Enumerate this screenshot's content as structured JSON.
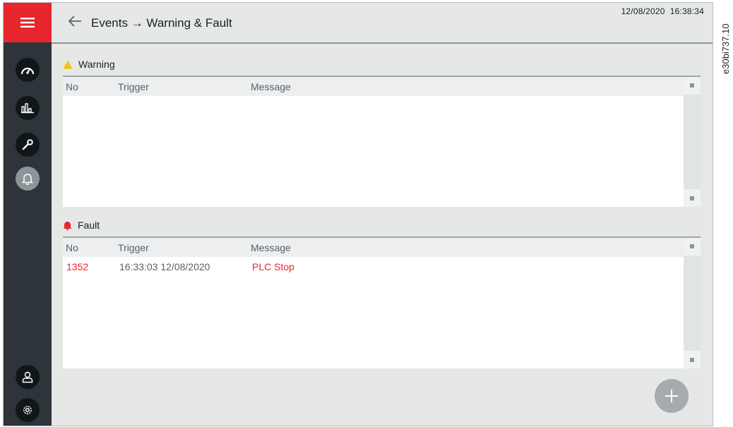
{
  "header": {
    "breadcrumb": "Events → Warning & Fault",
    "datetime": "12/08/2020  16:38:34"
  },
  "sidebar": {
    "items": [
      {
        "name": "gauge-icon",
        "active": false
      },
      {
        "name": "chart-icon",
        "active": false
      },
      {
        "name": "wrench-icon",
        "active": false
      },
      {
        "name": "bell-icon",
        "active": true
      }
    ],
    "bottom": [
      {
        "name": "user-icon"
      },
      {
        "name": "gear-icon"
      }
    ]
  },
  "warning": {
    "title": "Warning",
    "icon": "warning-triangle-icon",
    "columns": [
      "No",
      "Trigger",
      "Message"
    ],
    "rows": []
  },
  "fault": {
    "title": "Fault",
    "icon": "bell-alert-icon",
    "columns": [
      "No",
      "Trigger",
      "Message"
    ],
    "rows": [
      {
        "no": "1352",
        "trigger": "16:33:03 12/08/2020",
        "message": "PLC Stop"
      }
    ]
  },
  "fab": {
    "icon": "plus-icon"
  },
  "document_id": "e30bi737.10",
  "colors": {
    "accent_red": "#e8262d",
    "sidebar": "#2d353a",
    "warning_yellow": "#f5c400",
    "fault_text": "#e8262d"
  }
}
